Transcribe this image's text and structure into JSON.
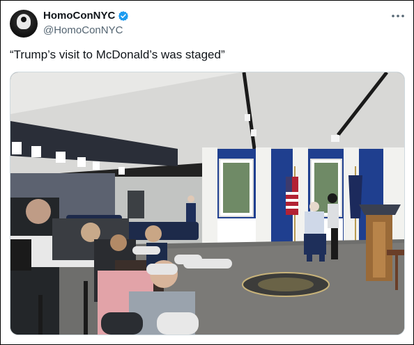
{
  "tweet": {
    "display_name": "HomoConNYC",
    "handle": "@HomoConNYC",
    "text": "“Trump’s visit to McDonald’s was staged”",
    "verified": true,
    "more_icon": "more-horizontal-icon",
    "colors": {
      "verified": "#1d9bf0",
      "handle": "#536471",
      "text": "#0f1419"
    }
  },
  "media": {
    "type": "photo",
    "content": "press event room with a seated man in a blue suit receiving a shot from a woman, flanked by American flags, a presidential podium, and a row of photographers in the foreground"
  }
}
